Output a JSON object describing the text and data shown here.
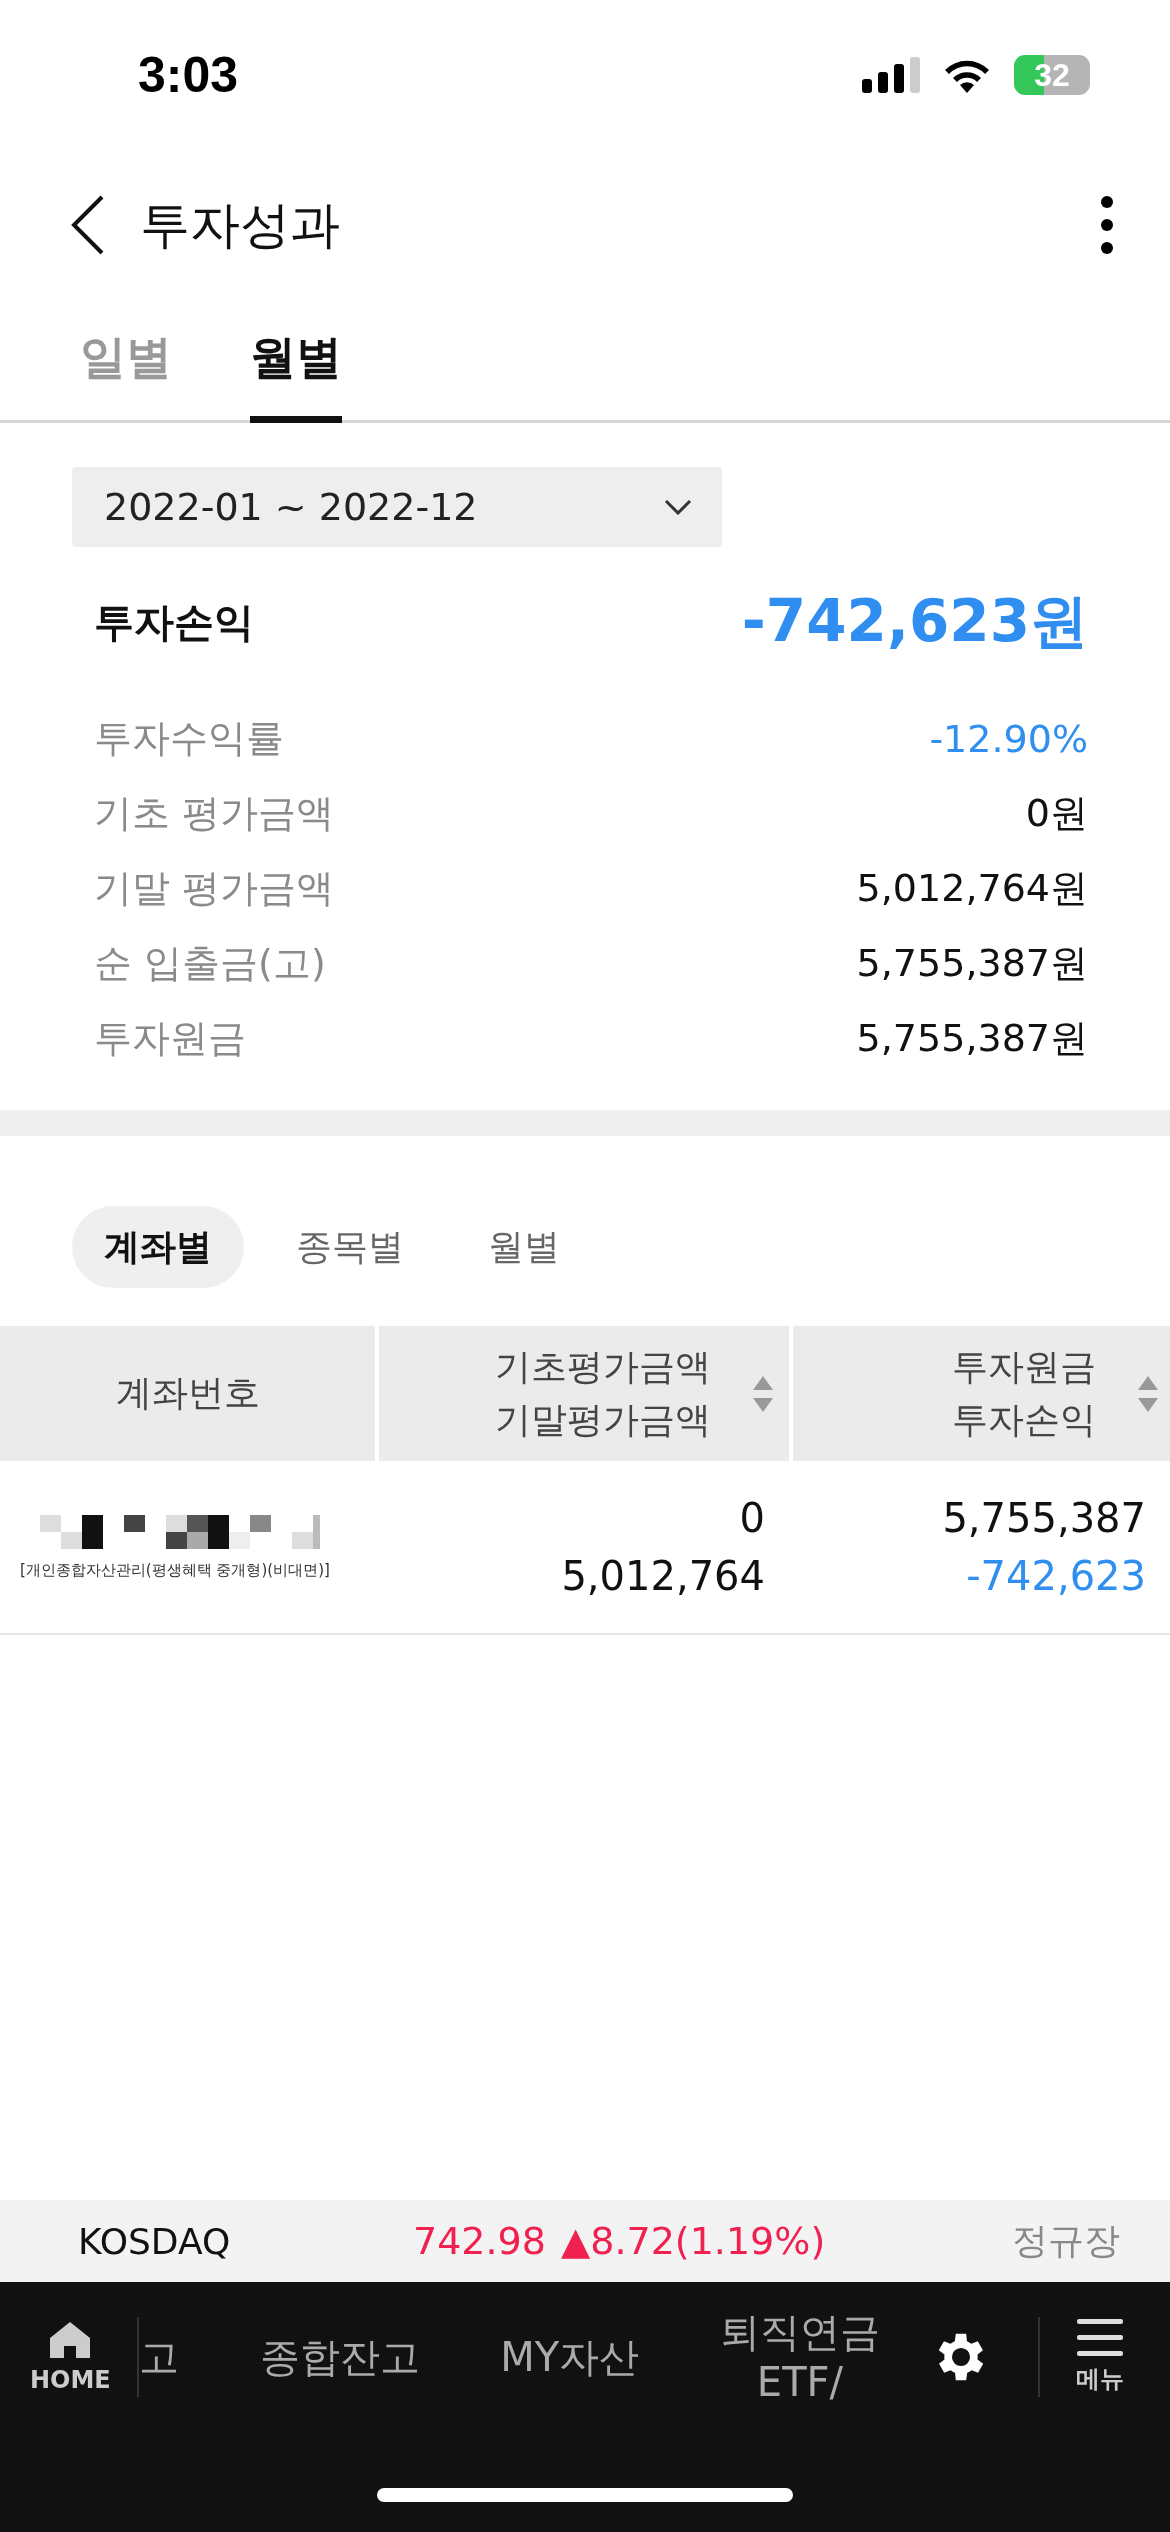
{
  "status_bar": {
    "time": "3:03",
    "battery": "32"
  },
  "header": {
    "title": "투자성과"
  },
  "tabs": [
    {
      "label": "일별",
      "selected": false
    },
    {
      "label": "월별",
      "selected": true
    }
  ],
  "period": {
    "value": "2022-01 ~ 2022-12"
  },
  "summary": {
    "label": "투자손익",
    "value": "-742,623원",
    "negative": true
  },
  "details": [
    {
      "label": "투자수익률",
      "value": "-12.90%",
      "negative": true
    },
    {
      "label": "기초 평가금액",
      "value": "0원",
      "negative": false
    },
    {
      "label": "기말 평가금액",
      "value": "5,012,764원",
      "negative": false
    },
    {
      "label": "순 입출금(고)",
      "value": "5,755,387원",
      "negative": false
    },
    {
      "label": "투자원금",
      "value": "5,755,387원",
      "negative": false
    }
  ],
  "segments": [
    {
      "label": "계좌별",
      "selected": true
    },
    {
      "label": "종목별",
      "selected": false
    },
    {
      "label": "월별",
      "selected": false
    }
  ],
  "table": {
    "columns": [
      {
        "lines": [
          "계좌번호"
        ],
        "sortable": false
      },
      {
        "lines": [
          "기초평가금액",
          "기말평가금액"
        ],
        "sortable": true
      },
      {
        "lines": [
          "투자원금",
          "투자손익"
        ],
        "sortable": true
      }
    ],
    "rows": [
      {
        "account_type": "[개인종합자산관리(평생혜택 중개형)(비대면)]",
        "start_value": "0",
        "end_value": "5,012,764",
        "principal": "5,755,387",
        "profit": "-742,623",
        "profit_negative": true
      }
    ]
  },
  "ticker": {
    "index": "KOSDAQ",
    "price": "742.98",
    "change": "▲8.72(1.19%)",
    "session": "정규장"
  },
  "bottom_nav": {
    "home": "HOME",
    "items": [
      "고",
      "종합잔고",
      "MY자산",
      "퇴직연금\nETF/"
    ],
    "menu": "메뉴"
  }
}
